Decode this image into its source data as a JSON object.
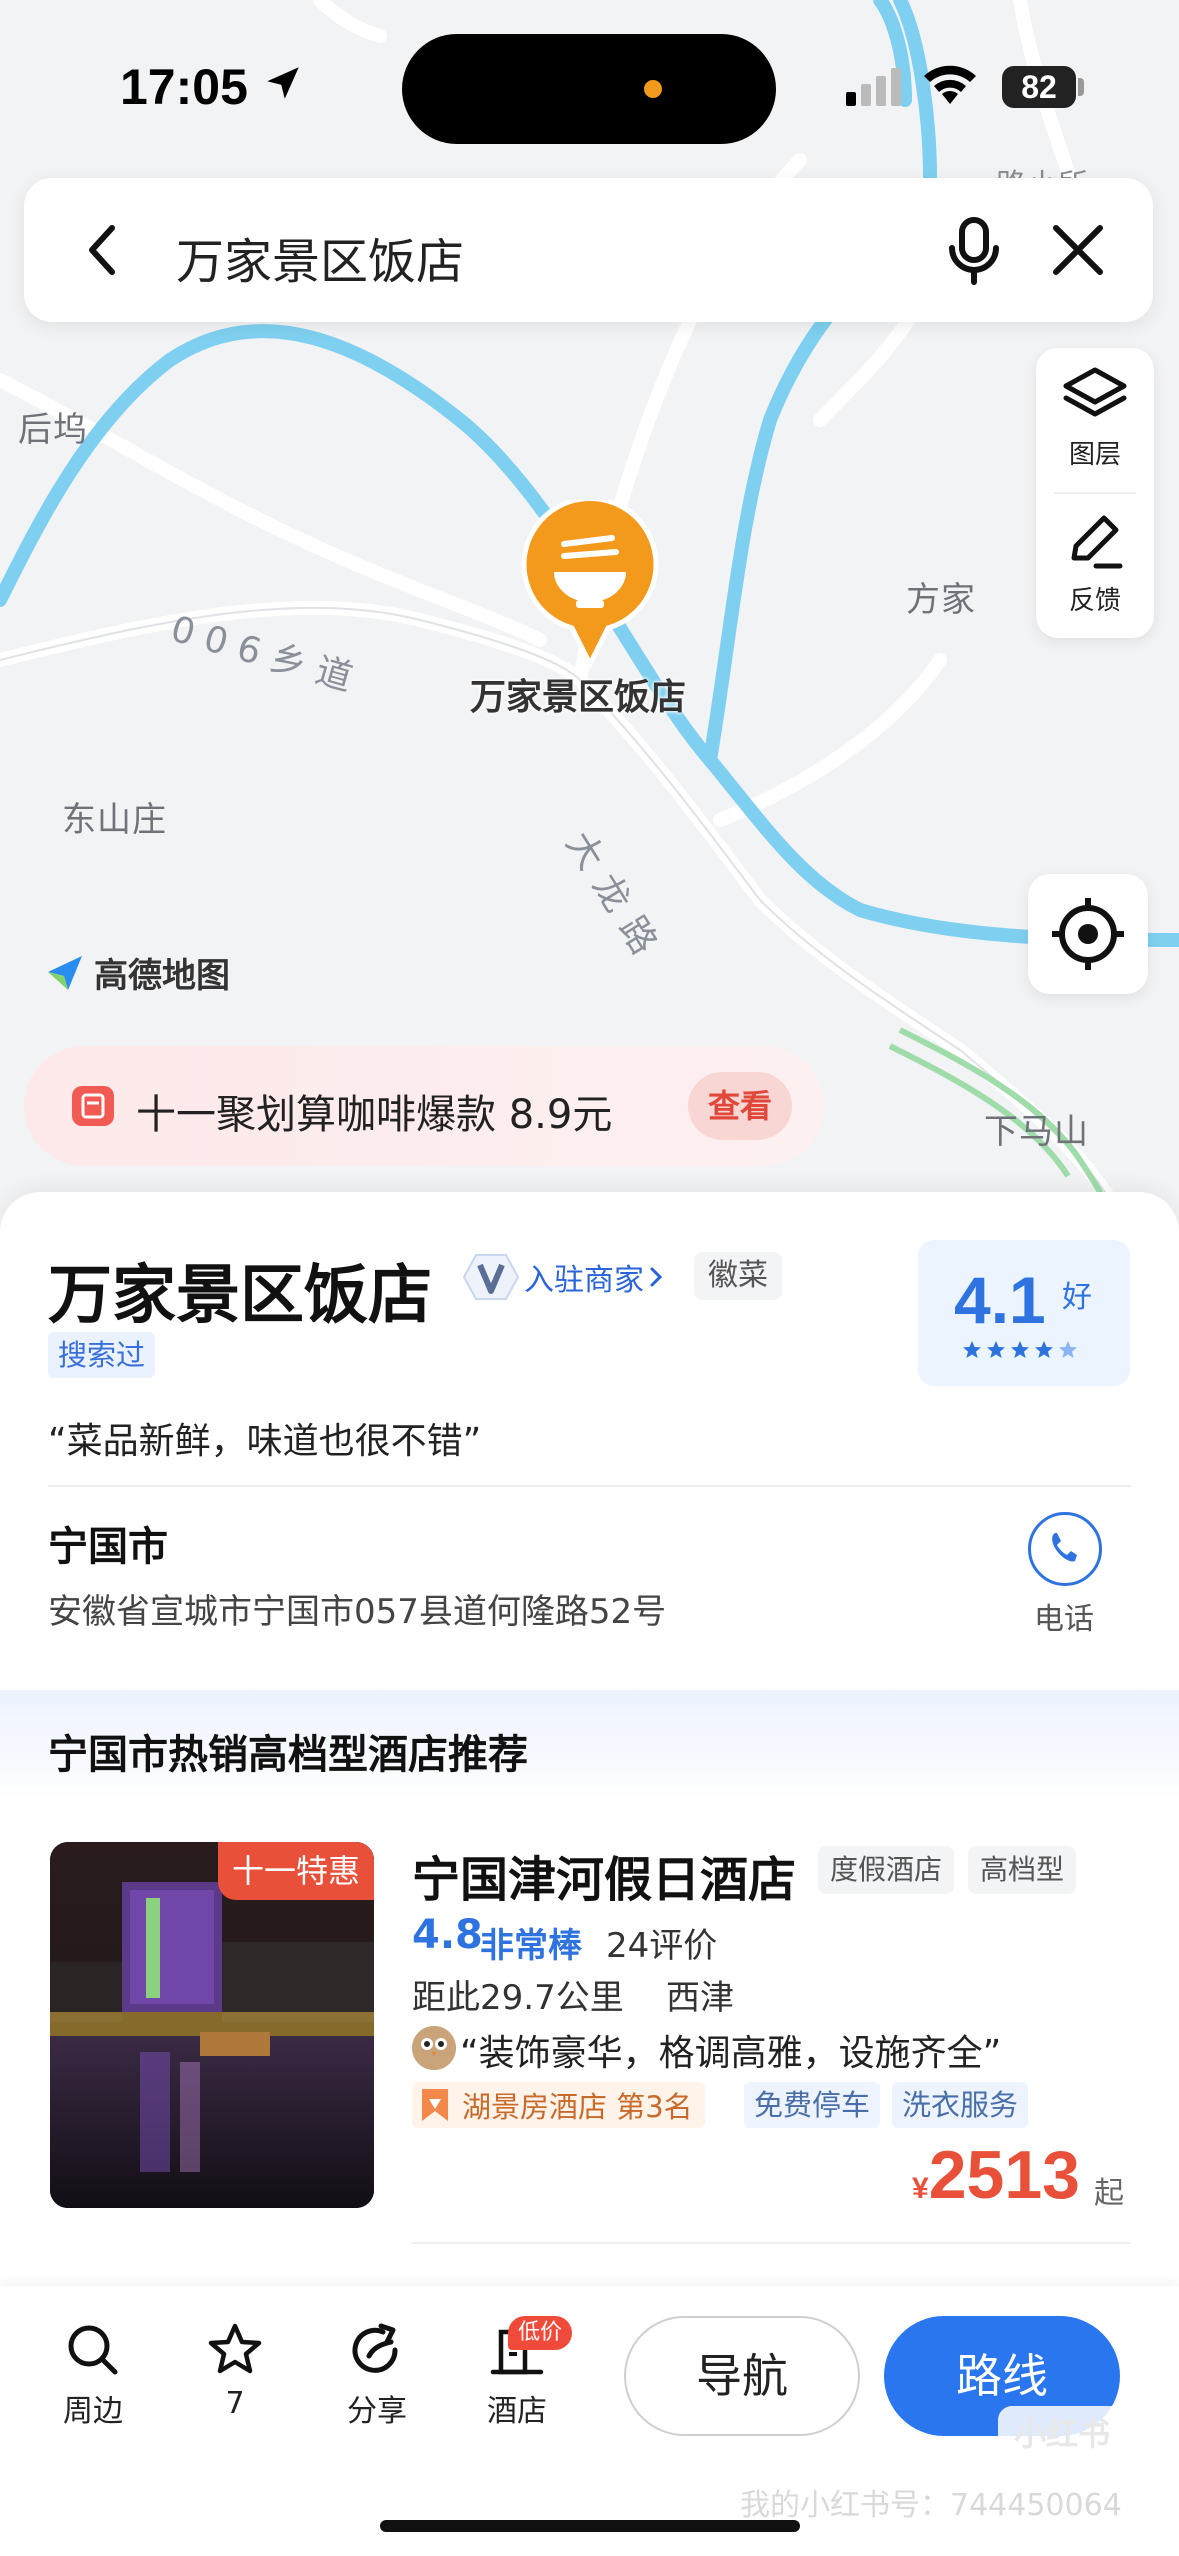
{
  "status_bar": {
    "time": "17:05",
    "battery": "82"
  },
  "search": {
    "query": "万家景区饭店"
  },
  "map": {
    "labels": {
      "houwu": "后坞",
      "fangjia": "方家",
      "dongshanzhuang": "东山庄",
      "xiamashan": "下马山",
      "road_006": "0 0 6 乡 道",
      "dalong_road": "大龙路",
      "corner": "路小所"
    },
    "marker_label": "万家景区饭店",
    "logo_text": "高德地图",
    "tools": {
      "layers": "图层",
      "feedback": "反馈"
    }
  },
  "promo": {
    "text": "十一聚划算咖啡爆款 8.9元",
    "button": "查看"
  },
  "poi": {
    "name": "万家景区饭店",
    "merchant_badge": "入驻商家",
    "cuisine": "徽菜",
    "searched_tag": "搜索过",
    "rating": "4.1",
    "rating_word": "好",
    "stars": 4.5,
    "quote": "“菜品新鲜，味道也很不错”",
    "city": "宁国市",
    "address": "安徽省宣城市宁国市057县道何隆路52号",
    "phone_label": "电话"
  },
  "recommend": {
    "title": "宁国市热销高档型酒店推荐",
    "hotel": {
      "badge": "十一特惠",
      "name": "宁国津河假日酒店",
      "tags": [
        "度假酒店",
        "高档型"
      ],
      "score": "4.8",
      "score_word": "非常棒",
      "reviews": "24评价",
      "distance": "距此29.7公里",
      "area": "西津",
      "quote": "“装饰豪华，格调高雅，设施齐全”",
      "rank": "湖景房酒店 第3名",
      "services": [
        "免费停车",
        "洗衣服务"
      ],
      "currency": "¥",
      "price": "2513",
      "price_suffix": "起"
    }
  },
  "bottom_bar": {
    "nearby": "周边",
    "favorite_count": "7",
    "share": "分享",
    "hotel": "酒店",
    "low_price_badge": "低价",
    "navigate": "导航",
    "route": "路线"
  },
  "watermark": {
    "logo": "小红书",
    "text": "我的小红书号：744450064"
  },
  "colors": {
    "accent": "#2a76ee",
    "river": "#7fd0f0",
    "marker": "#f39a1c",
    "price": "#e8503a"
  }
}
